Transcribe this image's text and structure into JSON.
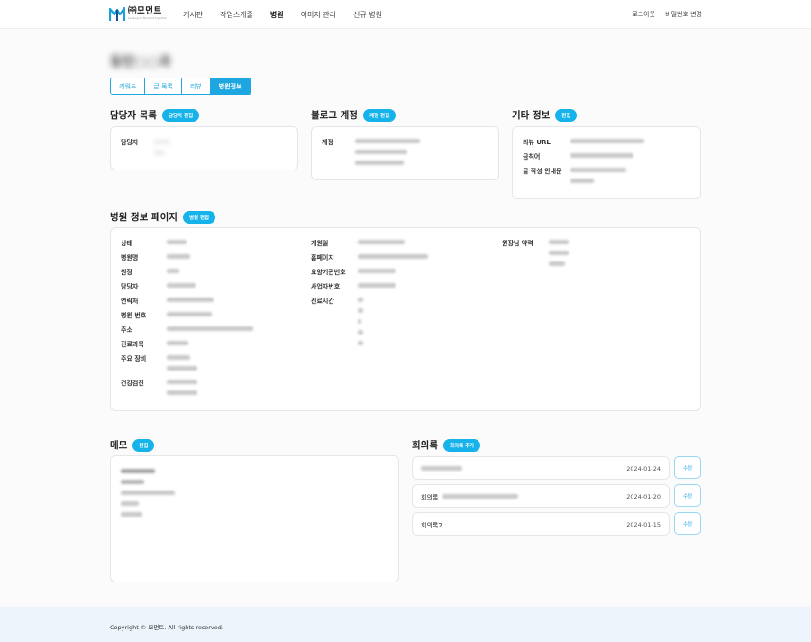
{
  "header": {
    "logo_text": "㈜모먼트",
    "logo_sub": "Leading to Moment together",
    "nav": [
      "게시판",
      "작업스케줄",
      "병원",
      "이미지 관리",
      "신규 병원"
    ],
    "active_nav": "병원",
    "logout": "로그아웃",
    "change_password": "비밀번호 변경"
  },
  "page": {
    "title": "동탄○○과"
  },
  "tabs": [
    "키워드",
    "글 목록",
    "리뷰",
    "병원정보"
  ],
  "active_tab": "병원정보",
  "contacts": {
    "title": "담당자 목록",
    "button": "담당자 편집",
    "label_manager": "담당자",
    "manager_name": "○○○",
    "manager_sub": "○○"
  },
  "blog": {
    "title": "블로그 계정",
    "button": "계정 편집",
    "label_account": "계정"
  },
  "other": {
    "title": "기타 정보",
    "button": "편집",
    "label_review_url": "리뷰 URL",
    "label_banned": "금칙어",
    "label_post_guide": "글 작성 안내문"
  },
  "hospital": {
    "title": "병원 정보 페이지",
    "button": "병원 편집",
    "left_labels": [
      "상태",
      "병원명",
      "원장",
      "담당자",
      "연락처",
      "병원 번호",
      "주소",
      "진료과목",
      "주요 장비",
      "건강검진"
    ],
    "mid_labels": [
      "개원일",
      "홈페이지",
      "요양기관번호",
      "사업자번호",
      "진료시간"
    ],
    "right_labels": [
      "원장님 약력"
    ]
  },
  "memo": {
    "title": "메모",
    "button": "편집"
  },
  "meeting": {
    "title": "회의록",
    "button": "회의록 추가",
    "rows": [
      {
        "title": "",
        "date": "2024-01-24",
        "edit": "수정"
      },
      {
        "title": "회의록",
        "date": "2024-01-20",
        "edit": "수정"
      },
      {
        "title": "회의록2",
        "date": "2024-01-15",
        "edit": "수정"
      }
    ]
  },
  "footer": {
    "copyright": "Copyright © 모먼트. All rights reserved."
  },
  "colors": {
    "accent": "#16b2ea",
    "footer_bg": "#eef4fb"
  }
}
